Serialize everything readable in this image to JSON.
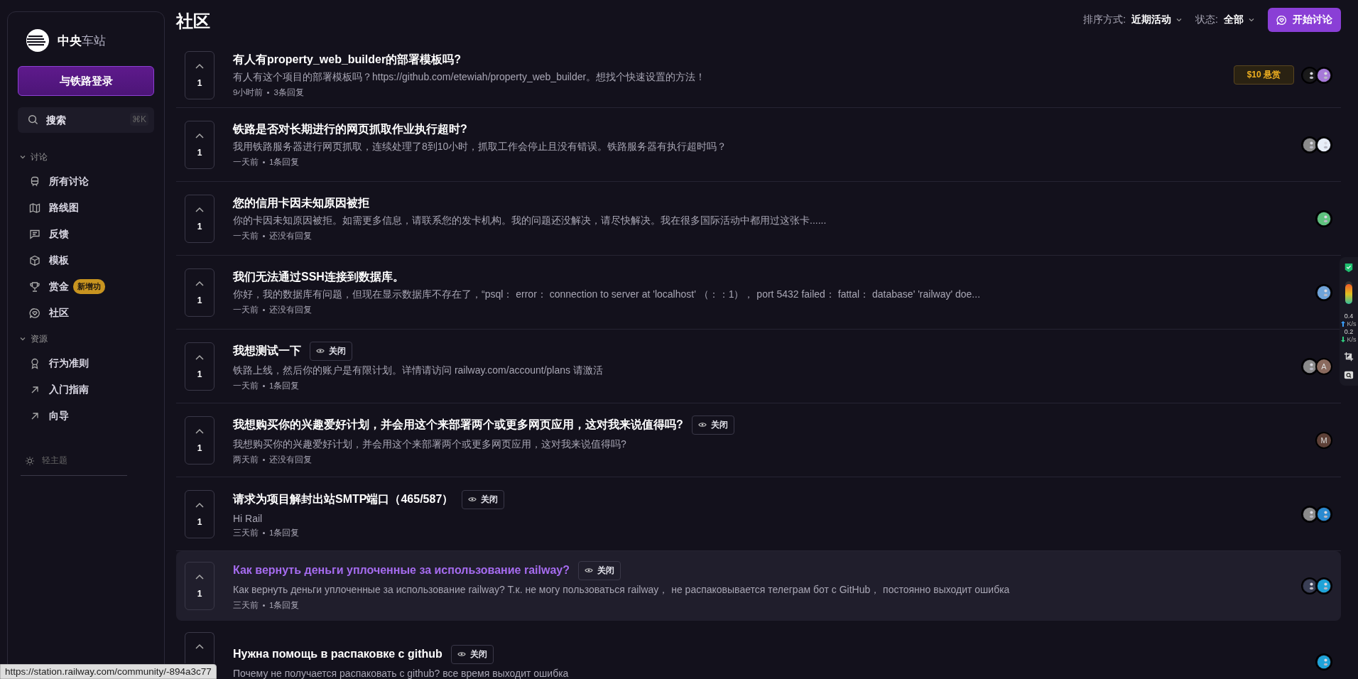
{
  "sidebar": {
    "brand": "**中央**车站",
    "login_button": "与铁路登录",
    "search": {
      "placeholder": "搜索",
      "shortcut": "⌘K"
    },
    "sections": [
      {
        "title": "讨论",
        "expanded": true,
        "items": [
          {
            "label": "所有讨论",
            "kind": "train"
          },
          {
            "label": "路线图",
            "kind": "map"
          },
          {
            "label": "反馈",
            "kind": "chat"
          },
          {
            "label": "模板",
            "kind": "box"
          },
          {
            "label": "赏金",
            "kind": "trophy",
            "badge": "新增功"
          },
          {
            "label": "社区",
            "kind": "community"
          }
        ]
      },
      {
        "title": "资源",
        "expanded": true,
        "items": [
          {
            "label": "行为准则",
            "kind": "award"
          },
          {
            "label": "入门指南",
            "kind": "link"
          },
          {
            "label": "向导",
            "kind": "link"
          }
        ]
      }
    ],
    "theme_toggle": "轻主题"
  },
  "header": {
    "title": "社区",
    "sort_label": "排序方式:",
    "sort_value": "近期活动",
    "status_label": "状态:",
    "status_value": "全部",
    "new_button": "开始讨论"
  },
  "posts": [
    {
      "votes": "1",
      "title": "有人有property_web_builder的部署模板吗?",
      "excerpt": "有人有这个项目的部署模板吗？https://github.com/etewiah/property_web_builder。想找个快速设置的方法！",
      "time": "9小时前",
      "replies": "3条回复",
      "bounty": "$10 悬赏",
      "highlighted": false,
      "avatars": [
        {
          "kind": "picture",
          "color": "#1a1a1a"
        },
        {
          "kind": "picture",
          "color": "#a77ad8"
        }
      ]
    },
    {
      "votes": "1",
      "title": "铁路是否对长期进行的网页抓取作业执行超时?",
      "excerpt": "我用铁路服务器进行网页抓取，连续处理了8到10小时，抓取工作会停止且没有错误。铁路服务器有执行超时吗？",
      "time": "一天前",
      "replies": "1条回复",
      "highlighted": false,
      "avatars": [
        {
          "kind": "picture",
          "color": "#8a8a8a"
        },
        {
          "kind": "picture",
          "color": "#e8eef8"
        }
      ]
    },
    {
      "votes": "1",
      "title": "您的信用卡因未知原因被拒",
      "excerpt": "你的卡因未知原因被拒。如需更多信息，请联系您的发卡机构。我的问题还没解决，请尽快解决。我在很多国际活动中都用过这张卡......",
      "time": "一天前",
      "replies": "还没有回复",
      "highlighted": false,
      "avatars": [
        {
          "kind": "picture",
          "color": "#5fc27e"
        }
      ]
    },
    {
      "votes": "1",
      "title": "我们无法通过SSH连接到数据库。",
      "excerpt": "你好，我的数据库有问题，但现在显示数据库不存在了，“psql： error： connection to server at 'localhost' （：：1）， port 5432 failed： fattal： database' 'railway' doe...",
      "time": "一天前",
      "replies": "还没有回复",
      "highlighted": false,
      "avatars": [
        {
          "kind": "picture",
          "color": "#6fa3d8"
        }
      ]
    },
    {
      "votes": "1",
      "title": "我想测试一下",
      "tag": "关闭",
      "excerpt": "铁路上线，然后你的账户是有限计划。详情请访问 railway.com/account/plans 请激活",
      "time": "一天前",
      "replies": "1条回复",
      "highlighted": false,
      "avatars": [
        {
          "kind": "picture",
          "color": "#8a8a8a"
        },
        {
          "kind": "letter",
          "letter": "A",
          "color": "#8a6a5e"
        }
      ]
    },
    {
      "votes": "1",
      "title": "我想购买你的兴趣爱好计划，并会用这个来部署两个或更多网页应用，这对我来说值得吗?",
      "tag": "关闭",
      "excerpt": "我想购买你的兴趣爱好计划，并会用这个来部署两个或更多网页应用，这对我来说值得吗?",
      "time": "两天前",
      "replies": "还没有回复",
      "highlighted": false,
      "avatars": [
        {
          "kind": "letter",
          "letter": "M",
          "color": "#5d4037"
        }
      ]
    },
    {
      "votes": "1",
      "title": "请求为项目解封出站SMTP端口（465/587）",
      "tag": "关闭",
      "excerpt": "Hi Rail",
      "time": "三天前",
      "replies": "1条回复",
      "highlighted": false,
      "avatars": [
        {
          "kind": "picture",
          "color": "#8a8a8a"
        },
        {
          "kind": "picture",
          "color": "#2a8ad0"
        }
      ]
    },
    {
      "votes": "1",
      "title": "Как вернуть деньги уплоченные за использование railway?",
      "tag": "关闭",
      "excerpt": "Как вернуть деньги уплоченные за использование railway?  Т.к. не могу пользоваться railway， не распаковывается телеграм бот с GitHub， постоянно выходит ошибка",
      "time": "三天前",
      "replies": "1条回复",
      "highlighted": true,
      "avatars": [
        {
          "kind": "picture",
          "color": "#3a3f55"
        },
        {
          "kind": "picture",
          "color": "#1fa3d8"
        }
      ]
    },
    {
      "title": "Нужна помощь в распаковке с github",
      "tag": "关闭",
      "excerpt": "Почему не получается распаковать с github?  все время выходит ошибка",
      "highlighted": false,
      "avatars": [
        {
          "kind": "picture",
          "color": "#1fa3d8"
        }
      ]
    }
  ],
  "side_widget": {
    "up_speed": "0.4",
    "up_unit": "K/s",
    "down_speed": "0.2",
    "down_unit": "K/s"
  },
  "status_bar": "https://station.railway.com/community/-894a3c77"
}
